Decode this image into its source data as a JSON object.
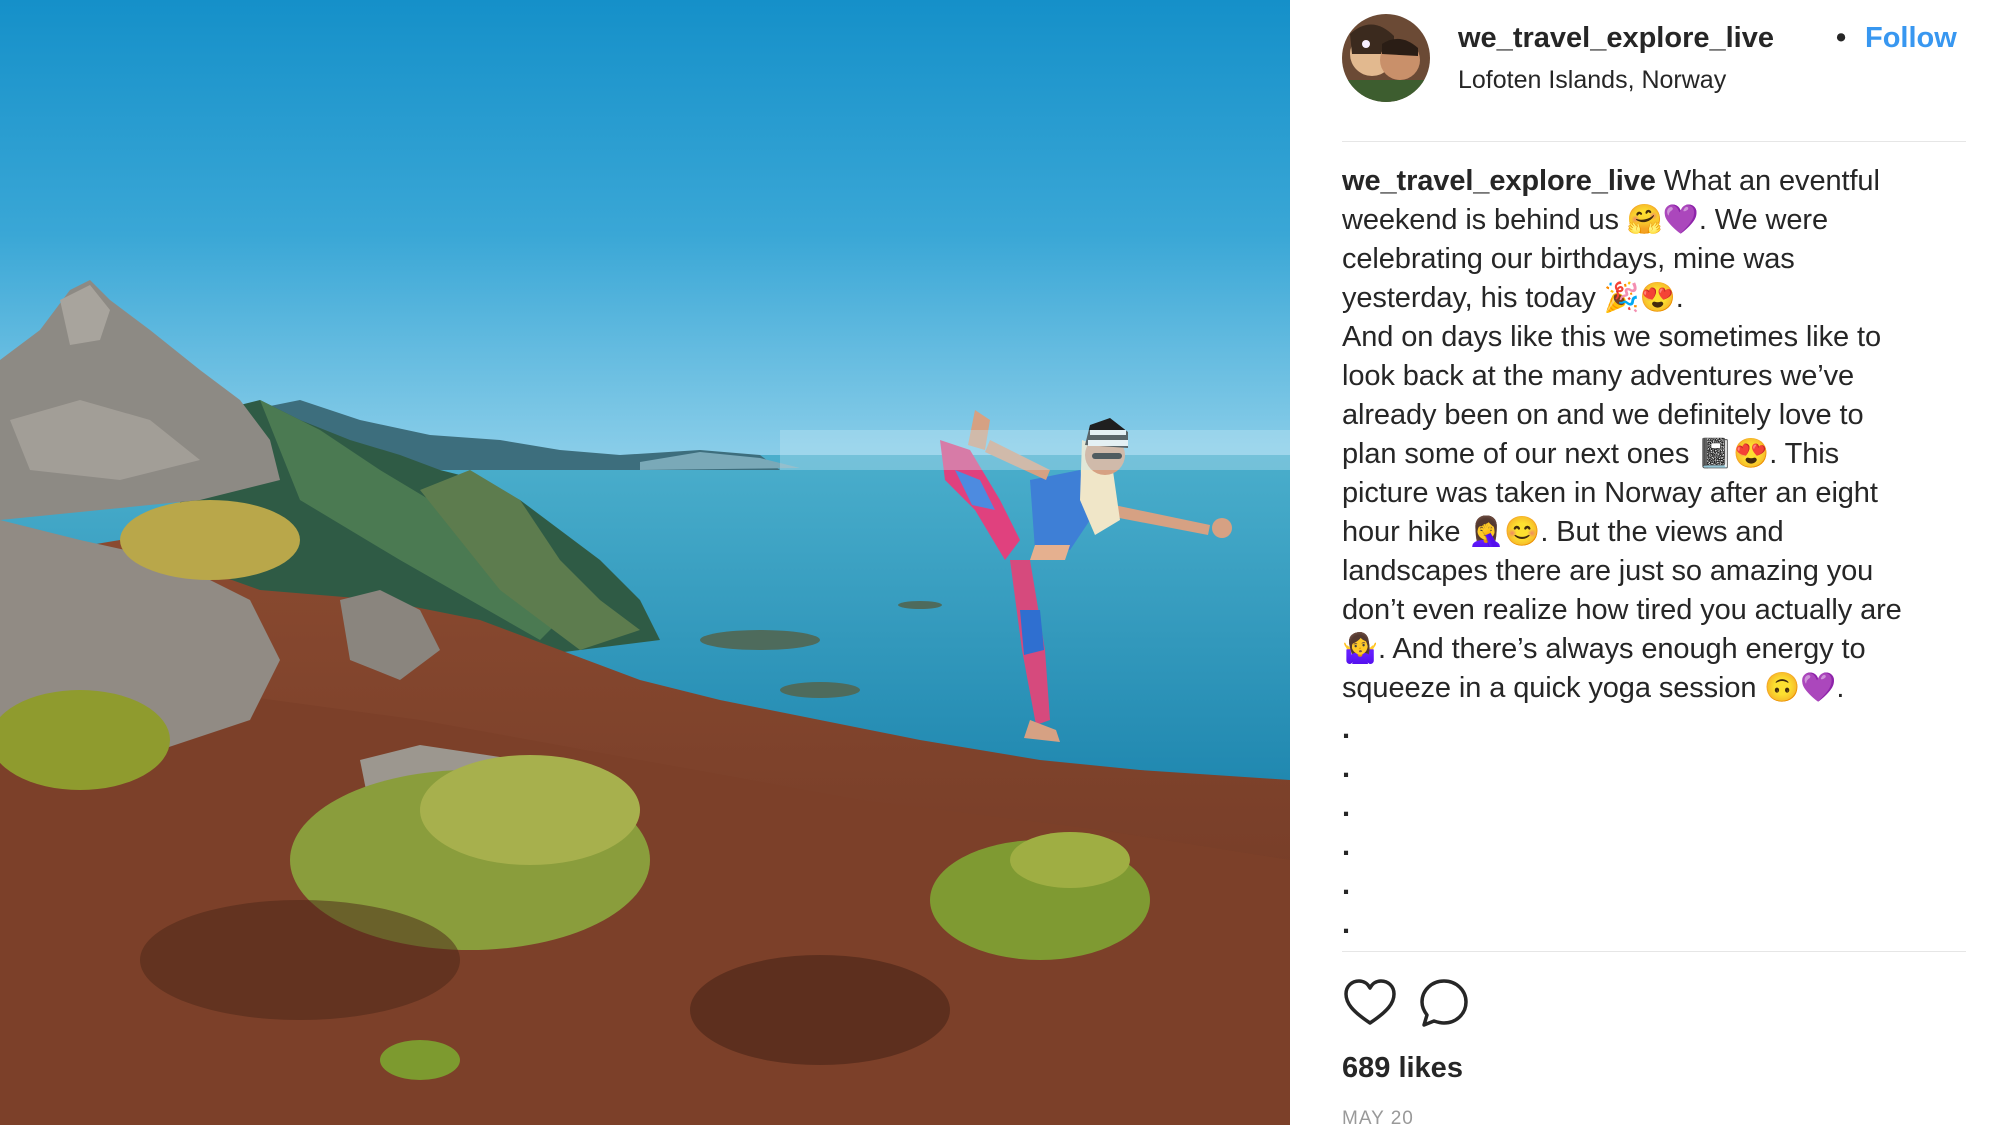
{
  "post": {
    "username": "we_travel_explore_live",
    "separator": "•",
    "follow_label": "Follow",
    "location": "Lofoten Islands, Norway"
  },
  "caption": {
    "username": "we_travel_explore_live",
    "lines": [
      " What an eventful",
      "weekend is behind us 🤗💜. We were",
      "celebrating our birthdays, mine was",
      "yesterday, his today 🎉😍.",
      "And on days like this we sometimes like to",
      "look back at the many adventures we’ve",
      "already been on and we definitely love to",
      "plan some of our next ones 📓😍. This",
      "picture was taken in Norway after an eight",
      "hour hike 🤦‍♀️😊. But the views and",
      "landscapes there are just so amazing you",
      "don’t even realize how tired you actually are",
      "🤷‍♀️. And there’s always enough energy to",
      "squeeze in a quick yoga session 🙃💜."
    ],
    "dots": [
      ".",
      ".",
      ".",
      ".",
      ".",
      "."
    ]
  },
  "actions": {
    "like_icon": "heart-icon",
    "comment_icon": "comment-icon"
  },
  "likes_label": "689 likes",
  "date_label": "MAY 20",
  "colors": {
    "follow": "#3897f0",
    "text": "#262626",
    "muted": "#999999",
    "divider": "#e6e6e6"
  }
}
